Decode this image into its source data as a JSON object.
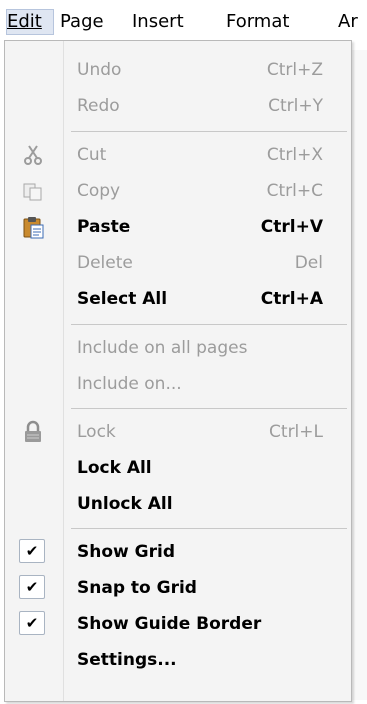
{
  "menubar": {
    "items": [
      "Edit",
      "Page",
      "Insert",
      "Format",
      "Ar"
    ]
  },
  "menu": {
    "undo": {
      "label": "Undo",
      "shortcut": "Ctrl+Z"
    },
    "redo": {
      "label": "Redo",
      "shortcut": "Ctrl+Y"
    },
    "cut": {
      "label": "Cut",
      "shortcut": "Ctrl+X"
    },
    "copy": {
      "label": "Copy",
      "shortcut": "Ctrl+C"
    },
    "paste": {
      "label": "Paste",
      "shortcut": "Ctrl+V"
    },
    "delete": {
      "label": "Delete",
      "shortcut": "Del"
    },
    "select_all": {
      "label": "Select All",
      "shortcut": "Ctrl+A"
    },
    "include_all": {
      "label": "Include on all pages"
    },
    "include_on": {
      "label": "Include on..."
    },
    "lock": {
      "label": "Lock",
      "shortcut": "Ctrl+L"
    },
    "lock_all": {
      "label": "Lock All"
    },
    "unlock_all": {
      "label": "Unlock All"
    },
    "show_grid": {
      "label": "Show Grid",
      "checked": true
    },
    "snap_grid": {
      "label": "Snap to Grid",
      "checked": true
    },
    "show_guide": {
      "label": "Show Guide Border",
      "checked": true
    },
    "settings": {
      "label": "Settings..."
    }
  },
  "icons": {
    "cut": "scissors-icon",
    "copy": "copy-icon",
    "paste": "clipboard-icon",
    "lock": "padlock-icon",
    "check": "checkmark-icon"
  },
  "colors": {
    "disabled_text": "#9c9c9c",
    "menu_background": "#f4f4f4",
    "active_menubar": "#dfe6f2"
  }
}
